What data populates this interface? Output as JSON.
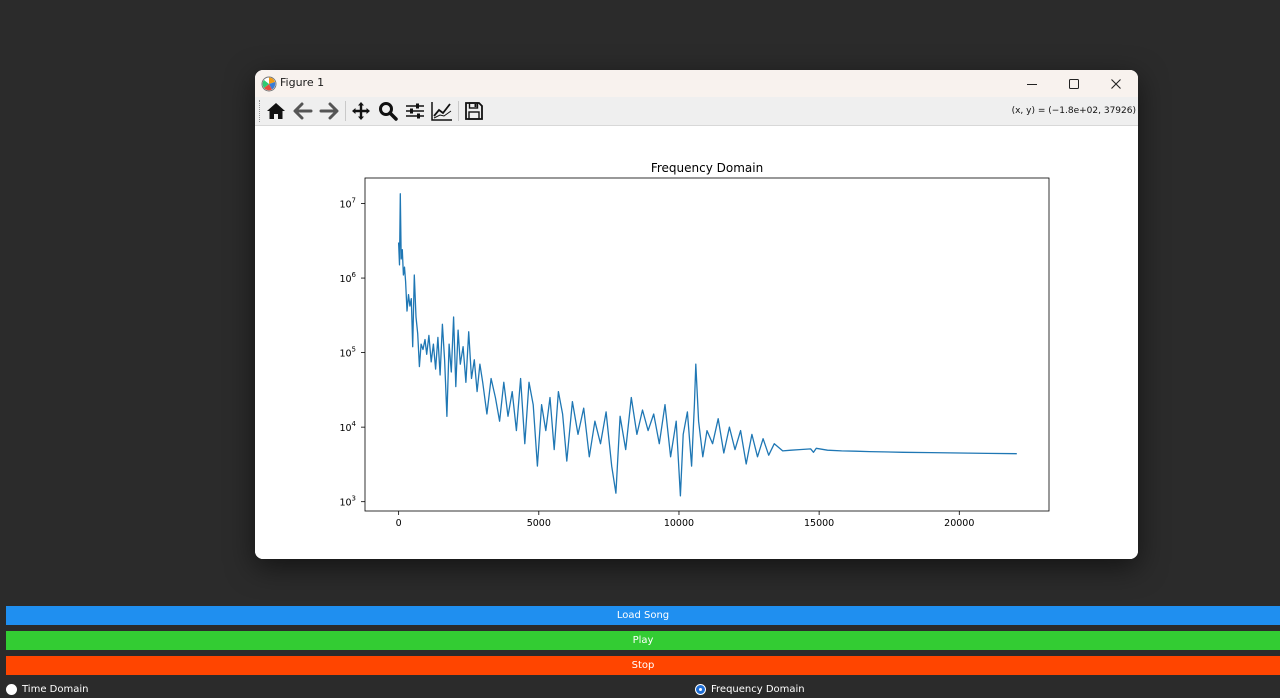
{
  "window": {
    "title": "Figure 1",
    "coords_readout": "(x, y) = (−1.8e+02, 37926)"
  },
  "toolbar": {
    "buttons": [
      {
        "name": "home",
        "icon": "home-icon"
      },
      {
        "name": "back",
        "icon": "arrow-left-icon"
      },
      {
        "name": "forward",
        "icon": "arrow-right-icon"
      },
      {
        "name": "pan",
        "icon": "move-icon"
      },
      {
        "name": "zoom",
        "icon": "magnifier-icon"
      },
      {
        "name": "configure-subplots",
        "icon": "sliders-icon"
      },
      {
        "name": "edit-axis",
        "icon": "line-chart-icon"
      },
      {
        "name": "save",
        "icon": "floppy-disk-icon"
      }
    ]
  },
  "chart_data": {
    "type": "line",
    "title": "Frequency Domain",
    "xlabel": "",
    "ylabel": "",
    "yscale": "log",
    "xlim": [
      -1200,
      23200
    ],
    "ylim": [
      750,
      22000000
    ],
    "xticks": [
      0,
      5000,
      10000,
      15000,
      20000
    ],
    "xtick_labels": [
      "0",
      "5000",
      "10000",
      "15000",
      "20000"
    ],
    "yticks": [
      1000,
      10000,
      100000,
      1000000,
      10000000
    ],
    "ytick_labels": [
      {
        "base": "10",
        "exp": "3"
      },
      {
        "base": "10",
        "exp": "4"
      },
      {
        "base": "10",
        "exp": "5"
      },
      {
        "base": "10",
        "exp": "6"
      },
      {
        "base": "10",
        "exp": "7"
      }
    ],
    "grid": false,
    "line_color": "#1f77b4",
    "series": [
      {
        "x": [
          0,
          30,
          60,
          90,
          130,
          170,
          210,
          250,
          300,
          350,
          400,
          450,
          500,
          560,
          620,
          680,
          740,
          800,
          870,
          940,
          1000,
          1080,
          1160,
          1240,
          1320,
          1400,
          1480,
          1560,
          1640,
          1720,
          1800,
          1880,
          1960,
          2040,
          2120,
          2200,
          2300,
          2400,
          2500,
          2600,
          2700,
          2800,
          2900,
          3000,
          3150,
          3300,
          3450,
          3600,
          3750,
          3900,
          4050,
          4200,
          4350,
          4500,
          4650,
          4800,
          4950,
          5100,
          5250,
          5400,
          5550,
          5700,
          5850,
          6000,
          6200,
          6400,
          6600,
          6800,
          7000,
          7200,
          7400,
          7600,
          7750,
          7900,
          8100,
          8300,
          8500,
          8700,
          8900,
          9100,
          9300,
          9500,
          9700,
          9900,
          10050,
          10150,
          10300,
          10450,
          10550,
          10600,
          10700,
          10850,
          11000,
          11200,
          11400,
          11600,
          11800,
          12000,
          12200,
          12400,
          12600,
          12800,
          13000,
          13200,
          13400,
          13700,
          14000,
          14300,
          14700,
          14800,
          14900,
          15300,
          15800,
          16300,
          16800,
          17300,
          18000,
          19000,
          20000,
          21000,
          22050
        ],
        "y": [
          3000000,
          1500000,
          13500000,
          1800000,
          2400000,
          1100000,
          1400000,
          900000,
          360000,
          600000,
          420000,
          530000,
          120000,
          1100000,
          300000,
          180000,
          65000,
          130000,
          110000,
          150000,
          95000,
          170000,
          75000,
          130000,
          60000,
          160000,
          50000,
          240000,
          80000,
          14000,
          130000,
          55000,
          300000,
          35000,
          200000,
          70000,
          120000,
          40000,
          190000,
          45000,
          80000,
          30000,
          70000,
          40000,
          15000,
          45000,
          25000,
          12000,
          40000,
          14000,
          30000,
          9000,
          45000,
          6000,
          40000,
          20000,
          3000,
          20000,
          9000,
          25000,
          5000,
          30000,
          15000,
          3500,
          22000,
          8000,
          18000,
          4000,
          12000,
          6000,
          16000,
          3000,
          1300,
          14000,
          5000,
          25000,
          8000,
          17000,
          9000,
          15000,
          6000,
          20000,
          4000,
          12000,
          1200,
          8000,
          16000,
          3000,
          20000,
          70000,
          12000,
          4000,
          9000,
          6000,
          13000,
          4500,
          10000,
          5000,
          9000,
          3200,
          8000,
          4000,
          7000,
          4200,
          6000,
          4800,
          4900,
          5000,
          5100,
          4600,
          5200,
          4900,
          4800,
          4750,
          4700,
          4650,
          4600,
          4550,
          4500,
          4450,
          4400
        ]
      }
    ]
  },
  "controls": {
    "load_label": "Load Song",
    "play_label": "Play",
    "stop_label": "Stop",
    "load_color": "#1f8ff0",
    "play_color": "#33cc33",
    "stop_color": "#ff4500"
  },
  "radios": {
    "time_label": "Time Domain",
    "freq_label": "Frequency Domain",
    "selected": "freq"
  }
}
